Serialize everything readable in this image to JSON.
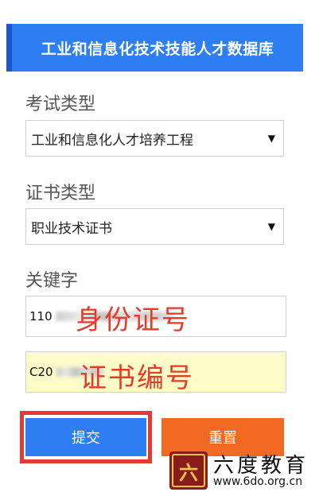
{
  "header": {
    "title": "工业和信息化技术技能人才数据库"
  },
  "form": {
    "exam_type": {
      "label": "考试类型",
      "selected": "工业和信息化人才培养工程"
    },
    "cert_type": {
      "label": "证书类型",
      "selected": "职业技术证书"
    },
    "keyword": {
      "label": "关键字",
      "id_value_prefix": "110",
      "cert_value_prefix": "C20"
    },
    "annotations": {
      "id_number": "身份证号",
      "cert_number": "证书编号"
    }
  },
  "buttons": {
    "submit": "提交",
    "reset": "重置"
  },
  "colors": {
    "header_bg": "#2e7ef3",
    "submit_bg": "#2e7ef3",
    "reset_bg": "#f26a21",
    "cert_input_bg": "#fdfbc8",
    "annotation": "#e53c2a",
    "highlight_border": "#e53935"
  },
  "watermark": {
    "logo_char": "六",
    "brand": "六度教育",
    "url": "www.6do.org.cn"
  }
}
